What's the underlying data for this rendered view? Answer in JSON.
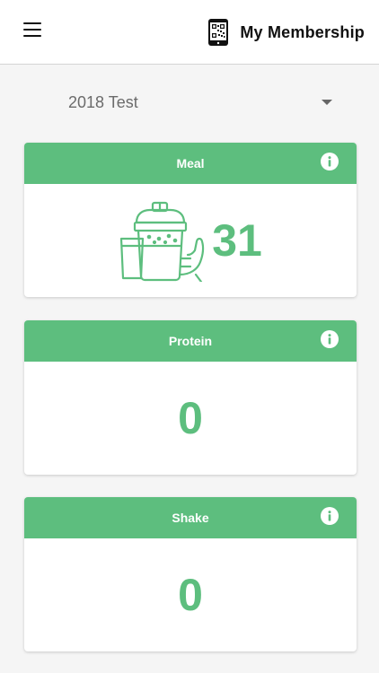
{
  "header": {
    "membership_label": "My Membership",
    "menu_icon": "hamburger-menu-icon",
    "membership_icon": "phone-qr-code-icon"
  },
  "selector": {
    "value": "2018 Test"
  },
  "cards": [
    {
      "title": "Meal",
      "value": "31",
      "illustration": "meal-shake-cup-icon"
    },
    {
      "title": "Protein",
      "value": "0"
    },
    {
      "title": "Shake",
      "value": "0"
    }
  ],
  "colors": {
    "accent": "#5dbe7e",
    "background": "#f5f5f5"
  }
}
